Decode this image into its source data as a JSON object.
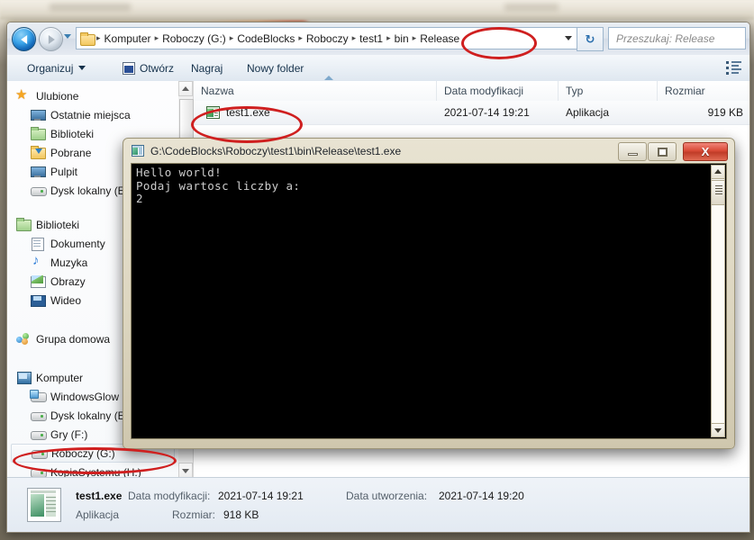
{
  "window": {
    "title": "Release",
    "navigation": {
      "back_label": "Wstecz",
      "forward_label": "Dalej",
      "recent_label": "Ostatnie lokalizacje"
    },
    "breadcrumb": {
      "separator": "▸",
      "items": [
        "Komputer",
        "Roboczy (G:)",
        "CodeBlocks",
        "Roboczy",
        "test1",
        "bin",
        "Release"
      ]
    },
    "refresh_glyph": "↻",
    "search": {
      "placeholder": "Przeszukaj: Release",
      "value": ""
    }
  },
  "toolbar": {
    "organize_label": "Organizuj",
    "open_label": "Otwórz",
    "burn_label": "Nagraj",
    "new_folder_label": "Nowy folder",
    "view_icon": "view-layout-icon"
  },
  "sidebar": {
    "groups": [
      {
        "header": {
          "label": "Ulubione",
          "icon": "star-icon"
        },
        "items": [
          {
            "label": "Ostatnie miejsca",
            "icon": "recent-places-icon"
          },
          {
            "label": "Biblioteki",
            "icon": "libraries-folder-icon"
          },
          {
            "label": "Pobrane",
            "icon": "downloads-folder-icon"
          },
          {
            "label": "Pulpit",
            "icon": "desktop-icon"
          },
          {
            "label": "Dysk lokalny (E",
            "icon": "drive-icon"
          }
        ]
      },
      {
        "header": {
          "label": "Biblioteki",
          "icon": "libraries-folder-icon"
        },
        "items": [
          {
            "label": "Dokumenty",
            "icon": "document-icon"
          },
          {
            "label": "Muzyka",
            "icon": "music-note-icon"
          },
          {
            "label": "Obrazy",
            "icon": "pictures-icon"
          },
          {
            "label": "Wideo",
            "icon": "video-icon"
          }
        ]
      },
      {
        "header": {
          "label": "Grupa domowa",
          "icon": "homegroup-icon"
        },
        "items": []
      },
      {
        "header": {
          "label": "Komputer",
          "icon": "computer-icon"
        },
        "items": [
          {
            "label": "WindowsGlow",
            "icon": "network-drive-icon"
          },
          {
            "label": "Dysk lokalny (E",
            "icon": "drive-icon"
          },
          {
            "label": "Gry (F:)",
            "icon": "drive-icon"
          },
          {
            "label": "Roboczy (G:)",
            "icon": "drive-icon",
            "selected": true
          },
          {
            "label": "KopiaSystemu (H:)",
            "icon": "drive-icon"
          }
        ]
      }
    ]
  },
  "file_list": {
    "columns": [
      "Nazwa",
      "Data modyfikacji",
      "Typ",
      "Rozmiar"
    ],
    "sorted_column": "Nazwa",
    "rows": [
      {
        "name": "test1.exe",
        "icon": "application-exe-icon",
        "modified": "2021-07-14 19:21",
        "type": "Aplikacja",
        "size": "919 KB",
        "selected": true
      }
    ]
  },
  "details_pane": {
    "thumbnail_icon": "application-exe-thumbnail",
    "file_name": "test1.exe",
    "file_type": "Aplikacja",
    "modified_key": "Data modyfikacji:",
    "modified_value": "2021-07-14 19:21",
    "created_key": "Data utworzenia:",
    "created_value": "2021-07-14 19:20",
    "size_key": "Rozmiar:",
    "size_value": "918 KB"
  },
  "console": {
    "title": "G:\\CodeBlocks\\Roboczy\\test1\\bin\\Release\\test1.exe",
    "icon": "console-app-icon",
    "buttons": {
      "minimize": "–",
      "maximize": "□",
      "close": "X"
    },
    "output": "Hello world!\nPodaj wartosc liczby a:\n2"
  },
  "annotations": {
    "color": "#cf1f1f",
    "marks": [
      {
        "name": "release-crumb-circle",
        "target": "Release"
      },
      {
        "name": "file-row-circle",
        "target": "test1.exe"
      },
      {
        "name": "roboczy-drive-circle",
        "target": "Roboczy (G:)"
      }
    ]
  }
}
